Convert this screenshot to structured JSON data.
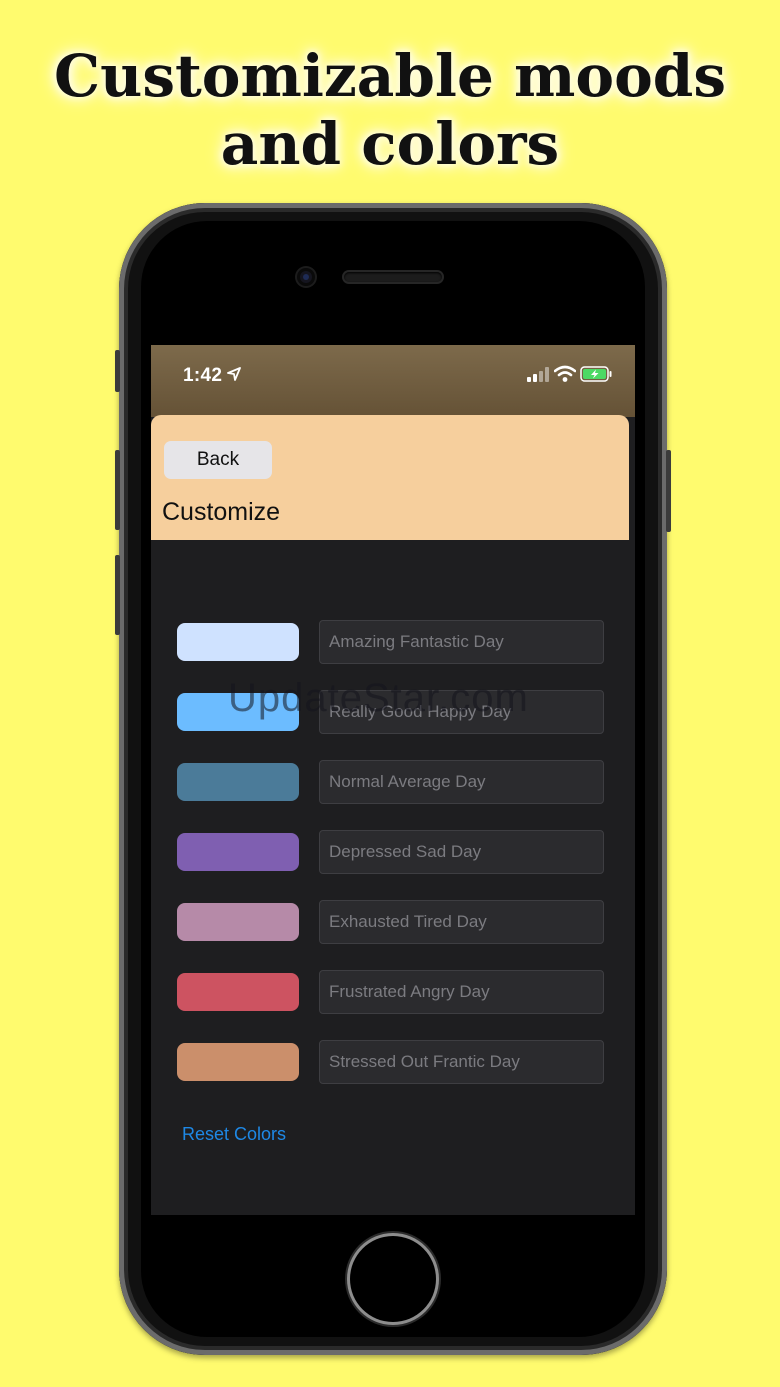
{
  "promo": {
    "headline_line1": "Customizable moods",
    "headline_line2": "and colors"
  },
  "status_bar": {
    "time": "1:42"
  },
  "header": {
    "back_label": "Back",
    "title": "Customize"
  },
  "moods": [
    {
      "color": "#cfe2ff",
      "placeholder": "Amazing Fantastic Day"
    },
    {
      "color": "#6cbcff",
      "placeholder": "Really Good Happy Day"
    },
    {
      "color": "#4b7b99",
      "placeholder": "Normal Average Day"
    },
    {
      "color": "#7f5fb1",
      "placeholder": "Depressed Sad Day"
    },
    {
      "color": "#b68aa8",
      "placeholder": "Exhausted Tired Day"
    },
    {
      "color": "#cd5361",
      "placeholder": "Frustrated Angry Day"
    },
    {
      "color": "#cb8f6b",
      "placeholder": "Stressed Out Frantic Day"
    }
  ],
  "reset_colors_label": "Reset Colors",
  "watermark": "UpdateStar.com",
  "colors": {
    "background": "#fffb6e",
    "header": "#f6cf9d",
    "screen": "#1e1e20",
    "link": "#1e88e5"
  }
}
